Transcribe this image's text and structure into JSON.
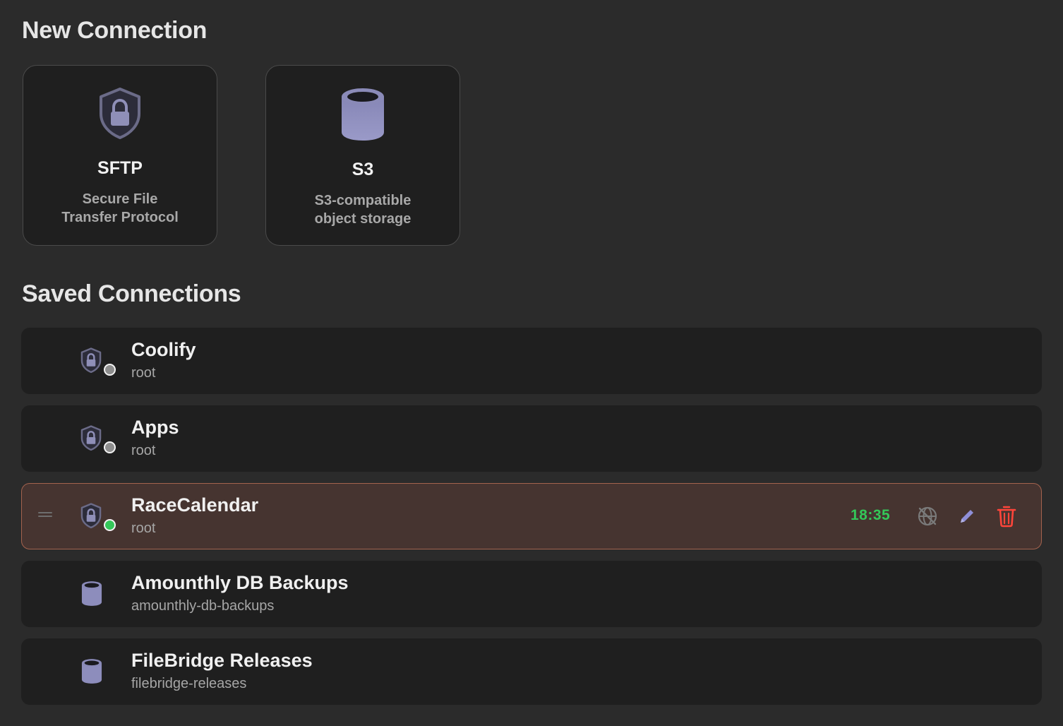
{
  "new_connection": {
    "title": "New Connection",
    "cards": [
      {
        "icon": "shield-lock-icon",
        "title": "SFTP",
        "desc_line1": "Secure File",
        "desc_line2": "Transfer Protocol"
      },
      {
        "icon": "database-icon",
        "title": "S3",
        "desc_line1": "S3-compatible",
        "desc_line2": "object storage"
      }
    ]
  },
  "saved_connections": {
    "title": "Saved Connections",
    "items": [
      {
        "type": "sftp",
        "name": "Coolify",
        "subtitle": "root",
        "status": "offline"
      },
      {
        "type": "sftp",
        "name": "Apps",
        "subtitle": "root",
        "status": "offline"
      },
      {
        "type": "sftp",
        "name": "RaceCalendar",
        "subtitle": "root",
        "status": "online",
        "time": "18:35",
        "actions": [
          "disconnect-icon",
          "edit-pencil-icon",
          "trash-icon"
        ]
      },
      {
        "type": "s3",
        "name": "Amounthly DB Backups",
        "subtitle": "amounthly-db-backups"
      },
      {
        "type": "s3",
        "name": "FileBridge Releases",
        "subtitle": "filebridge-releases"
      }
    ]
  },
  "colors": {
    "background": "#2b2b2b",
    "card": "#1f1f1f",
    "accent_icon": "#8f8fb8",
    "active_row": "#463430",
    "active_border": "#a4634e",
    "online": "#34c759",
    "offline": "#8d8d8d",
    "delete": "#ff453a",
    "edit": "#8f8fd8"
  }
}
